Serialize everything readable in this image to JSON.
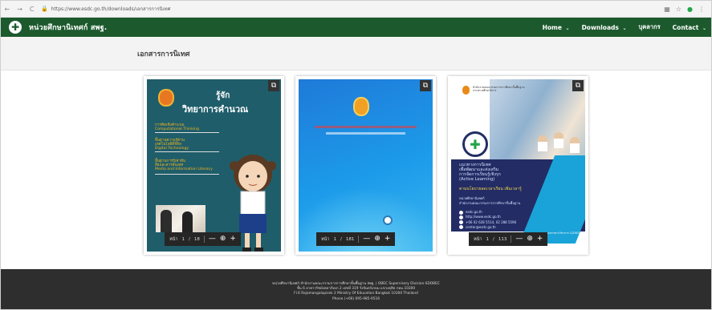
{
  "browser": {
    "url": "https://www.esdc.go.th/downloads/เอกสารการนิเทศ",
    "nav_back": "←",
    "nav_forward": "→",
    "nav_reload": "C",
    "lock": "🔒",
    "ext1": "▦",
    "ext2": "☆",
    "ext3": "●",
    "ext4": "⋮"
  },
  "navbar": {
    "brand": "หน่วยศึกษานิเทศก์ สพฐ.",
    "logo_glyph": "✚",
    "menu": [
      {
        "label": "Home",
        "caret": "⌄"
      },
      {
        "label": "Downloads",
        "caret": "⌄"
      },
      {
        "label": "บุคลากร",
        "caret": ""
      },
      {
        "label": "Contact",
        "caret": "⌄"
      }
    ]
  },
  "page": {
    "title": "เอกสารการนิเทศ"
  },
  "books": [
    {
      "cover_title_1": "รู้จัก",
      "cover_title_2": "วิทยาการคำนวณ",
      "labels": [
        "การคิดเชิงคำนวณ",
        "Computational Thinking",
        "พื้นฐานความรู้ด้าน",
        "เทคโนโลยีดิจิทัล",
        "Digital Technology",
        "พื้นฐานการรู้เท่าทัน",
        "สื่อและสารสนเทศ",
        "Media and Information Literacy"
      ],
      "page_label": "หน้า",
      "page_current": "1",
      "page_sep": "/",
      "page_total": "18"
    },
    {
      "page_label": "หน้า",
      "page_current": "1",
      "page_sep": "/",
      "page_total": "181"
    },
    {
      "heading": [
        "สำนักงานคณะกรรมการการศึกษาขั้นพื้นฐาน",
        "กระทรวงศึกษาธิการ"
      ],
      "title_lines": [
        "แนวทางการนิเทศ",
        "เพื่อพัฒนาและส่งเสริม",
        "การจัดการเรียนรู้เชิงรุก",
        "(Active Learning)"
      ],
      "subtitle": "ตามนโยบายลดเวลาเรียน เพิ่มเวลารู้",
      "org": [
        "หน่วยศึกษานิเทศก์",
        "สำนักงานคณะกรรมการการศึกษาขั้นพื้นฐาน"
      ],
      "contacts": [
        "esdc.go.th",
        "http://www.esdc.go.th",
        "+66 02 628 5514, 02 288 5596",
        "center@esdc.go.th"
      ],
      "note": "เอกสารทางวิชาการ 1/2562",
      "page_label": "หน้า",
      "page_current": "1",
      "page_sep": "/",
      "page_total": "113"
    }
  ],
  "viewer": {
    "zoom_out": "—",
    "zoom_in": "+",
    "zoom_icon": "⊕",
    "expand_icon": "⧉"
  },
  "footer": {
    "lines": [
      "หน่วยศึกษานิเทศก์ สำนักงานคณะกรรมการการศึกษาขั้นพื้นฐาน สพฐ. | OBEC Supervisory Division-SDOBEC",
      "ชั้น 6 อาคารรัชมังคลาภิเษก 2 เลขที่ 319 วังจันทร์เกษม แขวงดุสิต กทม.10300",
      "Fl.6 Rajamangalapisek 2 Ministry Of Education Bangkok 10300 Thailand",
      "Phone (+66) 095-985-9516"
    ]
  }
}
